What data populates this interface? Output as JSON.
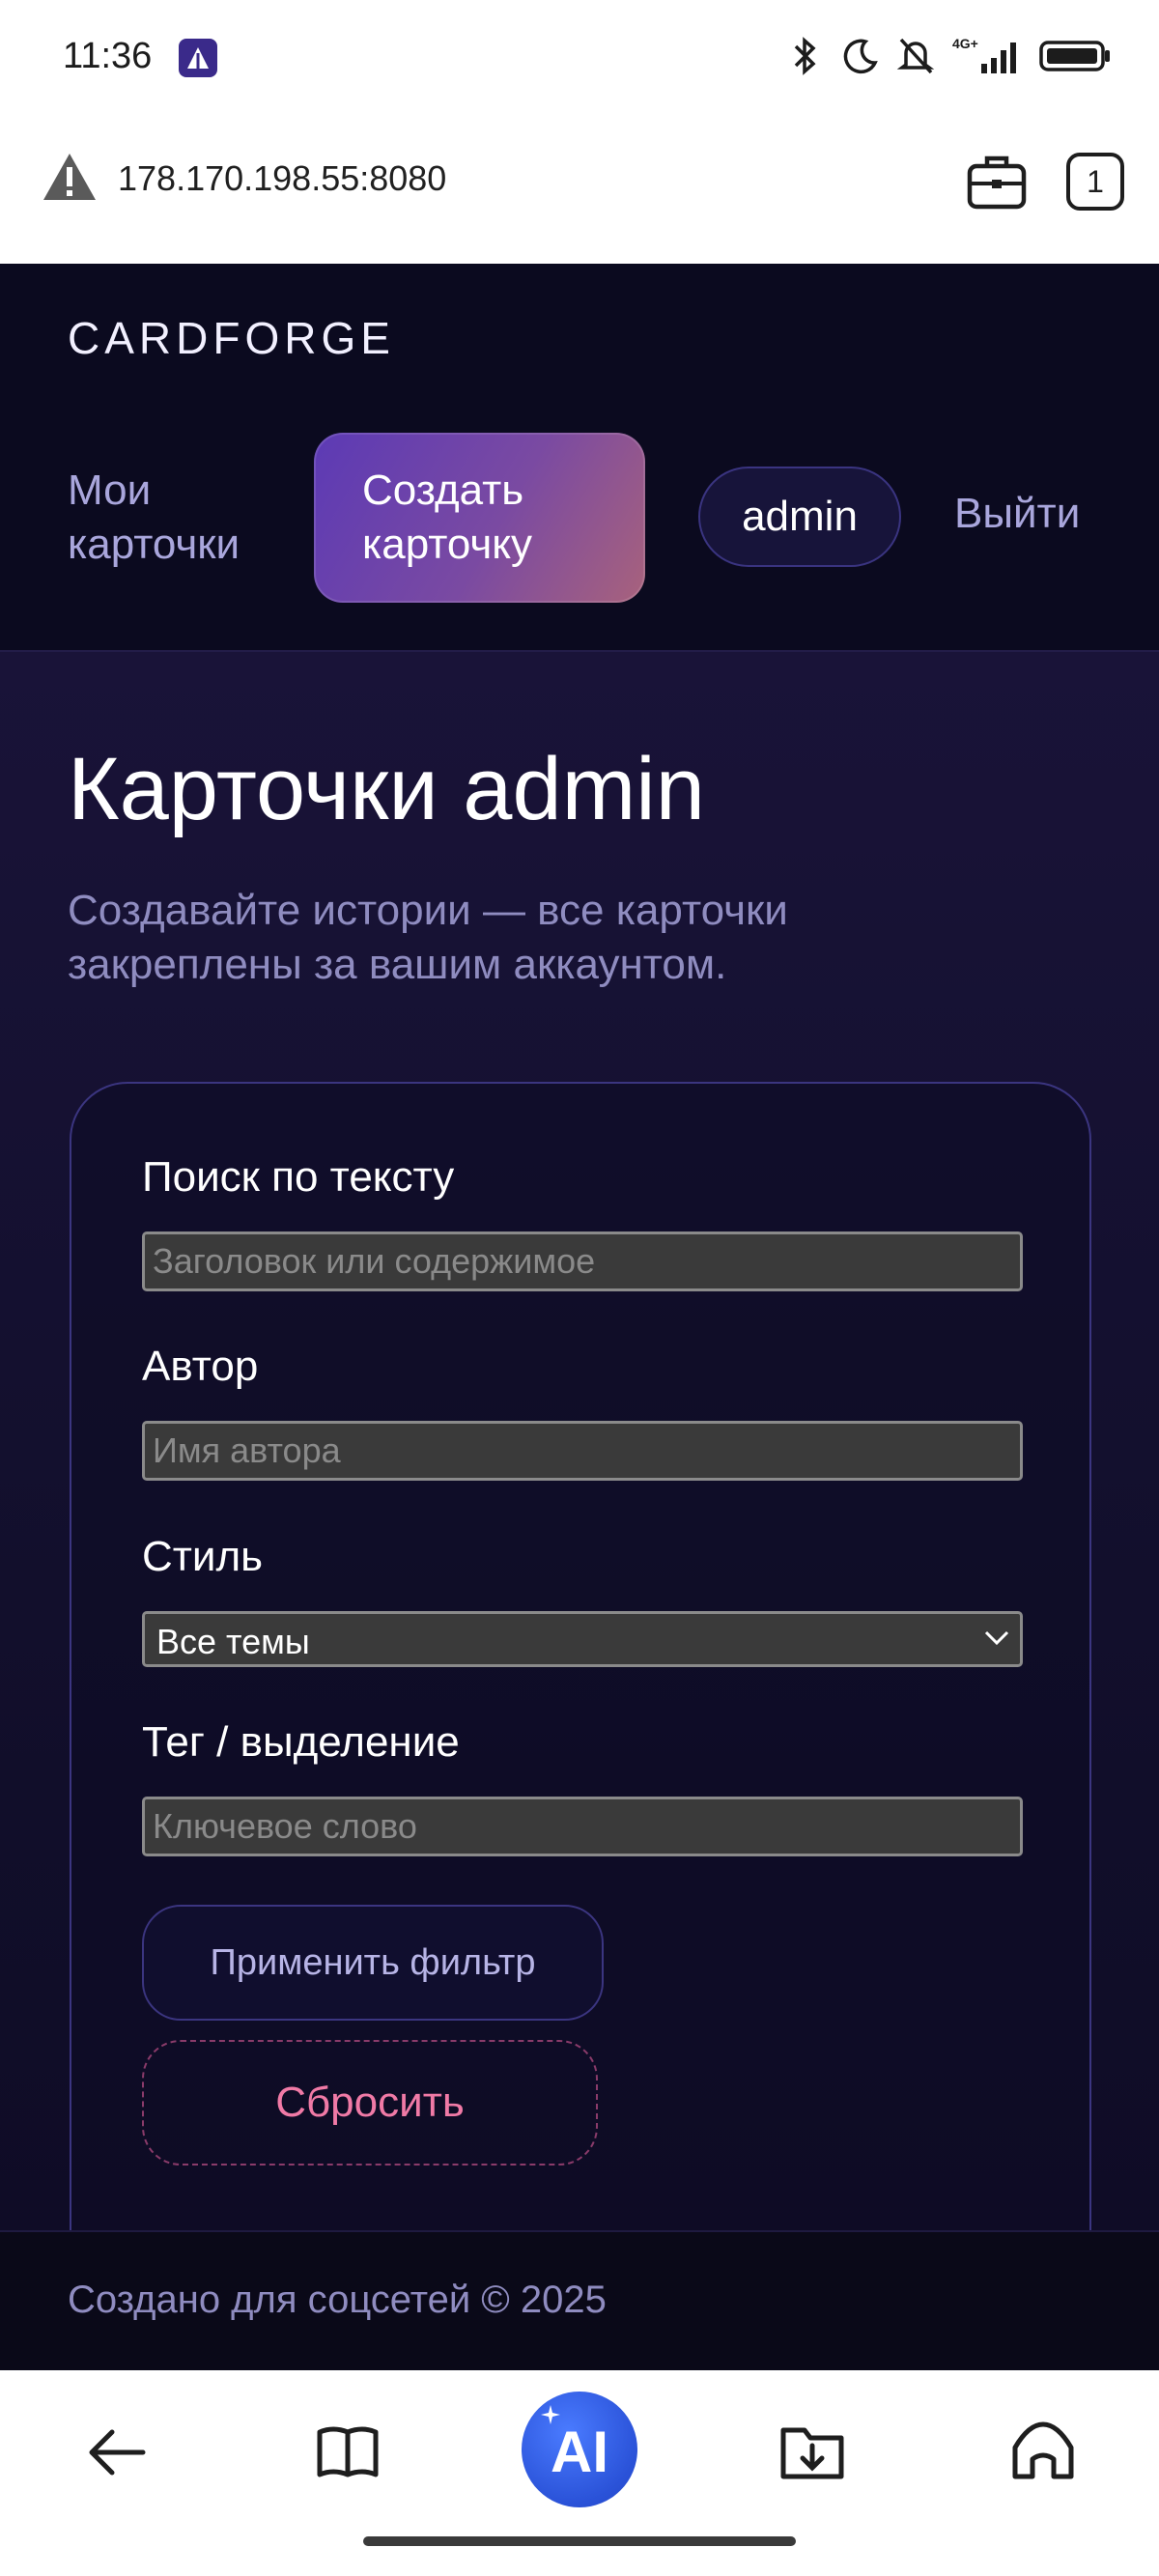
{
  "status_bar": {
    "time": "11:36",
    "signal": "4G+"
  },
  "browser": {
    "url": "178.170.198.55:8080",
    "tab_count": "1"
  },
  "header": {
    "brand": "CARDFORGE",
    "nav": {
      "my_cards": "Мои карточки",
      "create_card": "Создать карточку",
      "user": "admin",
      "logout": "Выйти"
    }
  },
  "main": {
    "title": "Карточки admin",
    "subtitle": "Создавайте истории — все карточки закреплены за вашим аккаунтом.",
    "filter": {
      "search_label": "Поиск по тексту",
      "search_placeholder": "Заголовок или содержимое",
      "author_label": "Автор",
      "author_placeholder": "Имя автора",
      "style_label": "Стиль",
      "style_value": "Все темы",
      "tag_label": "Тег / выделение",
      "tag_placeholder": "Ключевое слово",
      "apply_button": "Применить фильтр",
      "reset_button": "Сбросить"
    }
  },
  "footer": {
    "text": "Создано для соцсетей © 2025"
  },
  "bottom_nav": {
    "ai_label": "AI"
  },
  "colors": {
    "accent_gradient_start": "#5c3ab5",
    "accent_gradient_end": "#a8627c",
    "reset": "#f07aa6",
    "ai": "#2a52d8"
  }
}
